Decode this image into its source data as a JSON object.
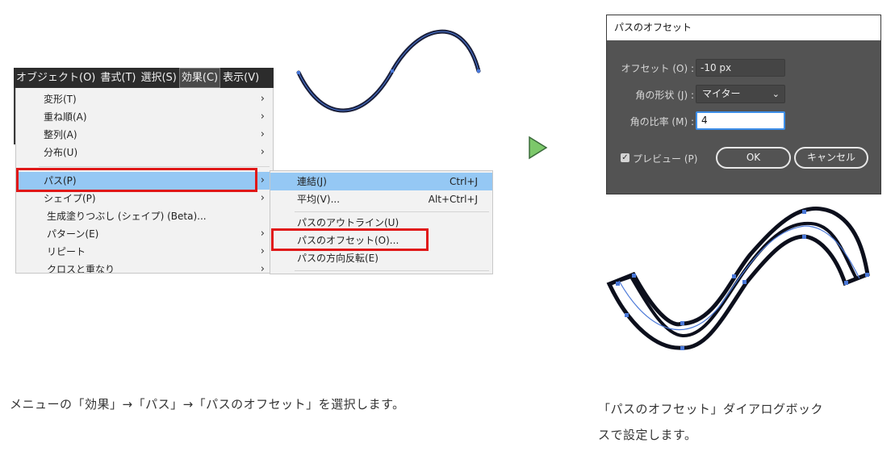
{
  "menubar": {
    "items": [
      "オブジェクト(O)",
      "書式(T)",
      "選択(S)",
      "効果(C)",
      "表示(V)"
    ]
  },
  "menu": {
    "items_top": [
      "変形(T)",
      "重ね順(A)",
      "整列(A)",
      "分布(U)"
    ],
    "items_bottom": [
      "パス(P)",
      "シェイプ(P)",
      "生成塗りつぶし (シェイプ) (Beta)...",
      "パターン(E)",
      "リピート",
      "クロスと重なり"
    ]
  },
  "submenu": {
    "items": [
      {
        "label": "連結(J)",
        "shortcut": "Ctrl+J"
      },
      {
        "label": "平均(V)...",
        "shortcut": "Alt+Ctrl+J"
      },
      {
        "label": "パスのアウトライン(U)",
        "shortcut": ""
      },
      {
        "label": "パスのオフセット(O)...",
        "shortcut": ""
      },
      {
        "label": "パスの方向反転(E)",
        "shortcut": ""
      }
    ]
  },
  "dialog": {
    "title": "パスのオフセット",
    "offset_label": "オフセット (O) :",
    "offset_value": "-10 px",
    "joins_label": "角の形状 (J) :",
    "joins_value": "マイター",
    "miter_label": "角の比率 (M) :",
    "miter_value": "4",
    "preview_label": "プレビュー (P)",
    "preview_checked": true,
    "ok_label": "OK",
    "cancel_label": "キャンセル"
  },
  "captions": {
    "left": "メニューの「効果」→「パス」→「パスのオフセット」を選択します。",
    "right_line1": "「パスのオフセット」ダイアログボック",
    "right_line2": "スで設定します。"
  },
  "colors": {
    "menubar_bg": "#2c2c2c",
    "highlight": "#95c8f4",
    "red_box": "#e01818",
    "arrow_green": "#7cc86a",
    "path_navy": "#1a1f3a",
    "anchor_blue": "#4a78d8",
    "dialog_bg": "#535353"
  },
  "icons": {
    "submenu_arrow": "chevron-right-icon",
    "next_step": "triangle-right-icon",
    "dropdown": "chevron-down-icon",
    "checkbox": "check-icon"
  }
}
